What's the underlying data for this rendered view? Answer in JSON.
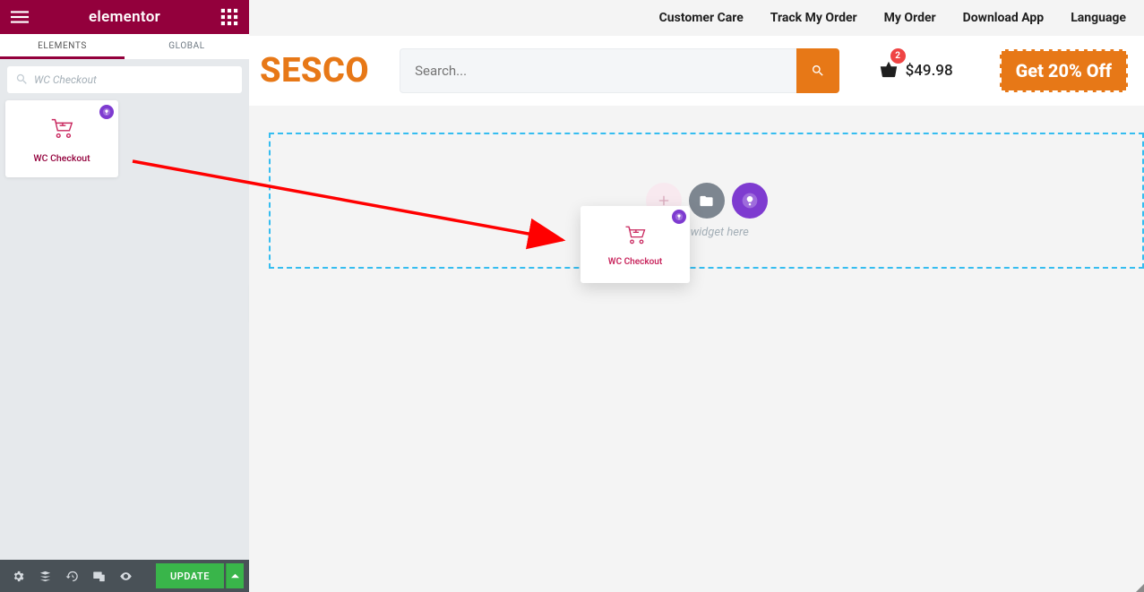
{
  "sidebar": {
    "logo": "elementor",
    "tabs": [
      "ELEMENTS",
      "GLOBAL"
    ],
    "activeTabIndex": 0,
    "searchValue": "WC Checkout",
    "widgets": [
      {
        "label": "WC Checkout",
        "iconName": "cart-icon",
        "badge": "eael"
      }
    ],
    "updateLabel": "UPDATE"
  },
  "preview": {
    "topnav": [
      "Customer Care",
      "Track My Order",
      "My Order",
      "Download App",
      "Language"
    ],
    "brand": "SESCO",
    "searchPlaceholder": "Search...",
    "cart": {
      "badge": "2",
      "total": "$49.98"
    },
    "promo": "Get 20% Off",
    "dropzoneText": "Drag widget here",
    "ghostLabel": "WC Checkout"
  },
  "colors": {
    "elementorRed": "#93003c",
    "orange": "#e77817",
    "ea": "#7e3bd0",
    "dashBlue": "#35bdf0"
  }
}
